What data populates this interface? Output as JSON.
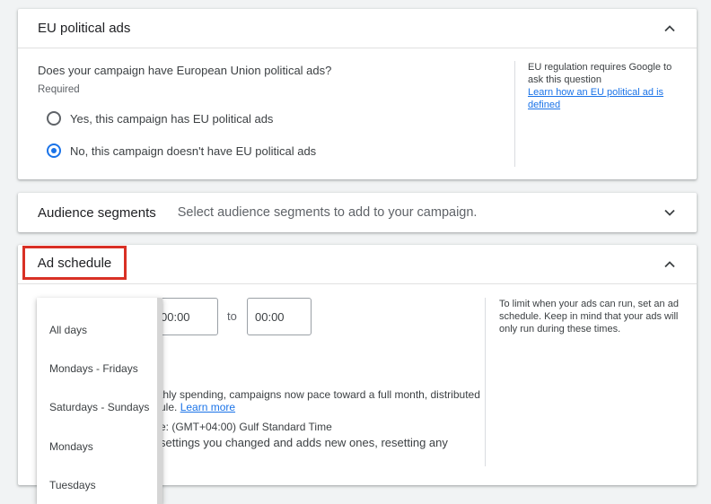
{
  "eu": {
    "title": "EU political ads",
    "question": "Does your campaign have European Union political ads?",
    "required": "Required",
    "options": [
      {
        "label": "Yes, this campaign has EU political ads",
        "selected": false
      },
      {
        "label": "No, this campaign doesn't have EU political ads",
        "selected": true
      }
    ],
    "side_text": "EU regulation requires Google to ask this question",
    "side_link": "Learn how an EU political ad is defined"
  },
  "audience": {
    "title": "Audience segments",
    "subtitle": "Select audience segments to add to your campaign."
  },
  "schedule": {
    "title": "Ad schedule",
    "start_time": "00:00",
    "to_label": "to",
    "end_time": "00:00",
    "line1": "thly spending, campaigns now pace toward a full month, distributed",
    "line2_text": "ule.",
    "line2_link": "Learn more",
    "line3": "e: (GMT+04:00) Gulf Standard Time",
    "line4": "settings you changed and adds new ones, resetting any",
    "side_text": "To limit when your ads can run, set an ad schedule. Keep in mind that your ads will only run during these times."
  },
  "dropdown": {
    "items": [
      "All days",
      "Mondays - Fridays",
      "Saturdays - Sundays",
      "Mondays",
      "Tuesdays"
    ]
  },
  "colors": {
    "accent": "#1a73e8",
    "highlight": "#d93025"
  }
}
